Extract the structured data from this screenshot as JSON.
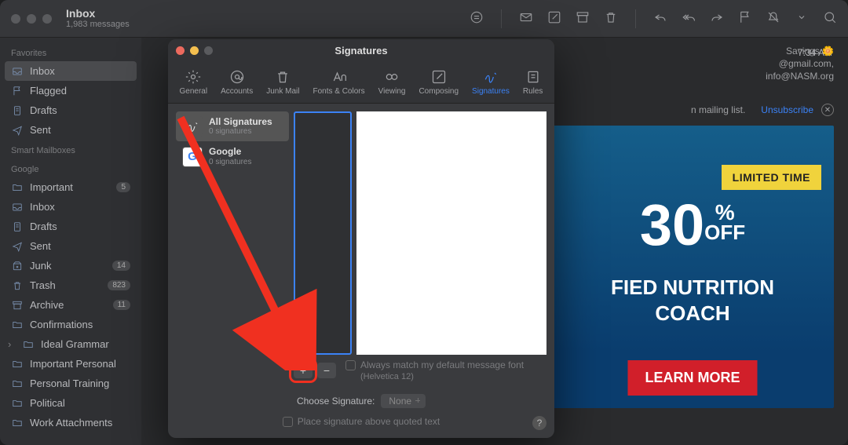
{
  "header": {
    "title": "Inbox",
    "subtitle": "1,983 messages"
  },
  "sidebar": {
    "favorites_label": "Favorites",
    "favorites": [
      {
        "label": "Inbox",
        "icon": "inbox",
        "active": true
      },
      {
        "label": "Flagged",
        "icon": "flag"
      },
      {
        "label": "Drafts",
        "icon": "doc"
      },
      {
        "label": "Sent",
        "icon": "send"
      }
    ],
    "smart_label": "Smart Mailboxes",
    "google_label": "Google",
    "google": [
      {
        "label": "Important",
        "icon": "folder",
        "badge": "5"
      },
      {
        "label": "Inbox",
        "icon": "inbox"
      },
      {
        "label": "Drafts",
        "icon": "doc"
      },
      {
        "label": "Sent",
        "icon": "send"
      },
      {
        "label": "Junk",
        "icon": "junk",
        "badge": "14"
      },
      {
        "label": "Trash",
        "icon": "trash",
        "badge": "823"
      },
      {
        "label": "Archive",
        "icon": "archive",
        "badge": "11"
      },
      {
        "label": "Confirmations",
        "icon": "folder"
      },
      {
        "label": "Ideal Grammar",
        "icon": "folder",
        "chev": true
      },
      {
        "label": "Important Personal",
        "icon": "folder"
      },
      {
        "label": "Personal Training",
        "icon": "folder"
      },
      {
        "label": "Political",
        "icon": "folder"
      },
      {
        "label": "Work Attachments",
        "icon": "folder"
      }
    ]
  },
  "message": {
    "from": "Savings 🌼",
    "to1": "@gmail.com,",
    "to2": "info@NASM.org",
    "time": "7:34 AM",
    "bar": "n mailing list.",
    "unsubscribe": "Unsubscribe"
  },
  "banner": {
    "limited": "LIMITED TIME",
    "percent": "30",
    "pct": "%",
    "off": "OFF",
    "line1": "FIED NUTRITION",
    "line2": "COACH",
    "learn": "LEARN MORE"
  },
  "prefs": {
    "title": "Signatures",
    "tabs": [
      {
        "label": "General",
        "icon": "gear"
      },
      {
        "label": "Accounts",
        "icon": "at"
      },
      {
        "label": "Junk Mail",
        "icon": "bin"
      },
      {
        "label": "Fonts & Colors",
        "icon": "aa"
      },
      {
        "label": "Viewing",
        "icon": "eye"
      },
      {
        "label": "Composing",
        "icon": "compose"
      },
      {
        "label": "Signatures",
        "icon": "sig",
        "active": true
      },
      {
        "label": "Rules",
        "icon": "rules"
      }
    ],
    "accounts": [
      {
        "name": "All Signatures",
        "sub": "0 signatures",
        "sel": true,
        "icon": "sig"
      },
      {
        "name": "Google",
        "sub": "0 signatures",
        "icon": "google"
      }
    ],
    "add": "+",
    "remove": "−",
    "match": "Always match my default message font",
    "helvetica": "(Helvetica 12)",
    "choose_label": "Choose Signature:",
    "choose_value": "None",
    "place": "Place signature above quoted text",
    "help": "?"
  }
}
